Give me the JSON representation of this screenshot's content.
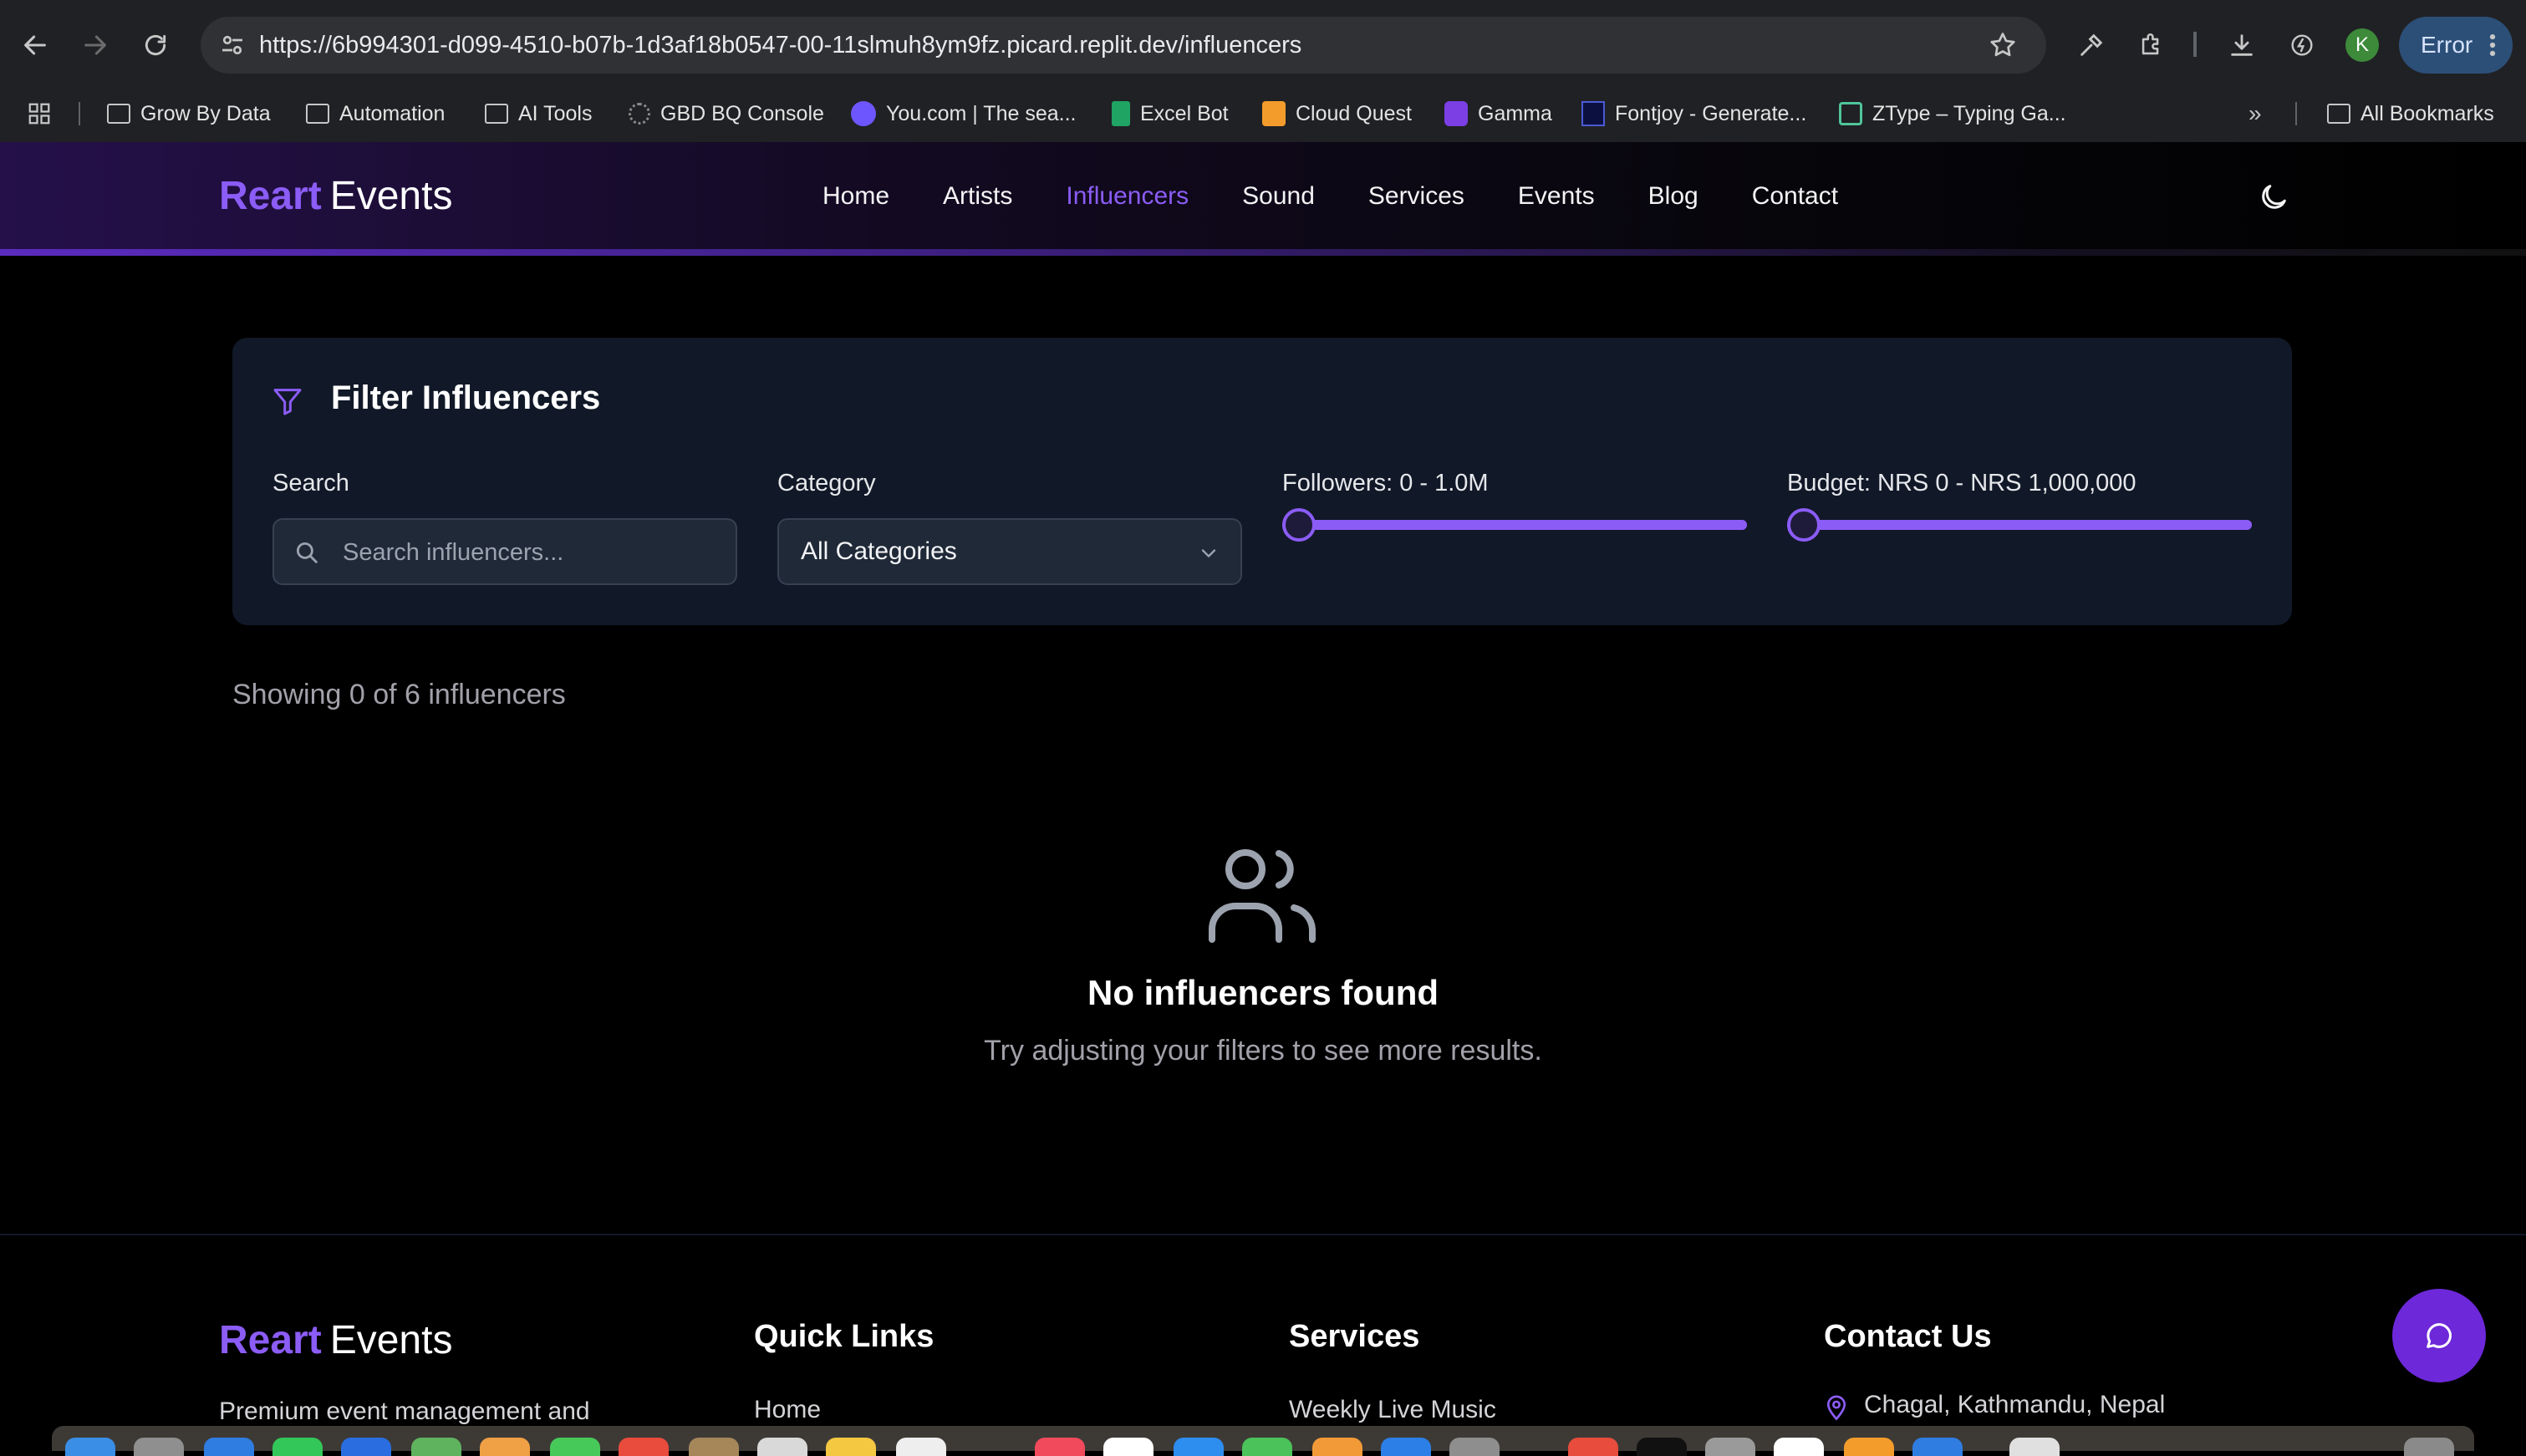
{
  "browser": {
    "url_host": "https://6b994301-d099-4510-b07b-1d3af18b0547-00-11slmuh8ym9fz.picard.replit.dev",
    "url_path": "/influencers",
    "profile_initial": "K",
    "error_label": "Error",
    "bookmarks": [
      {
        "label": "Grow By Data",
        "icon": "folder-icon"
      },
      {
        "label": "Automation",
        "icon": "folder-icon"
      },
      {
        "label": "AI Tools",
        "icon": "folder-icon"
      },
      {
        "label": "GBD BQ Console",
        "icon": "bigquery-icon"
      },
      {
        "label": "You.com | The sea...",
        "icon": "youcom-icon"
      },
      {
        "label": "Excel Bot",
        "icon": "sheets-icon"
      },
      {
        "label": "Cloud Quest",
        "icon": "cube-icon"
      },
      {
        "label": "Gamma",
        "icon": "gamma-icon"
      },
      {
        "label": "Fontjoy - Generate...",
        "icon": "fontjoy-icon"
      },
      {
        "label": "ZType – Typing Ga...",
        "icon": "ztype-icon"
      }
    ],
    "all_bookmarks": "All Bookmarks"
  },
  "site": {
    "logo_primary": "Reart",
    "logo_secondary": "Events",
    "nav": [
      "Home",
      "Artists",
      "Influencers",
      "Sound",
      "Services",
      "Events",
      "Blog",
      "Contact"
    ],
    "active_nav": "Influencers",
    "accent_color": "#8b5cf6"
  },
  "filters": {
    "title": "Filter Influencers",
    "search_label": "Search",
    "search_placeholder": "Search influencers...",
    "category_label": "Category",
    "category_value": "All Categories",
    "followers_label": "Followers: 0 - 1.0M",
    "followers_min_fraction": 0,
    "budget_label": "Budget: NRS 0 - NRS 1,000,000",
    "budget_min_fraction": 0
  },
  "results": {
    "showing": "Showing 0 of 6 influencers",
    "empty_title": "No influencers found",
    "empty_subtitle": "Try adjusting your filters to see more results."
  },
  "footer": {
    "logo_primary": "Reart",
    "logo_secondary": "Events",
    "tagline": "Premium event management and",
    "quick_links_title": "Quick Links",
    "quick_link_first": "Home",
    "services_title": "Services",
    "service_first": "Weekly Live Music",
    "contact_title": "Contact Us",
    "address": "Chagal, Kathmandu, Nepal"
  }
}
